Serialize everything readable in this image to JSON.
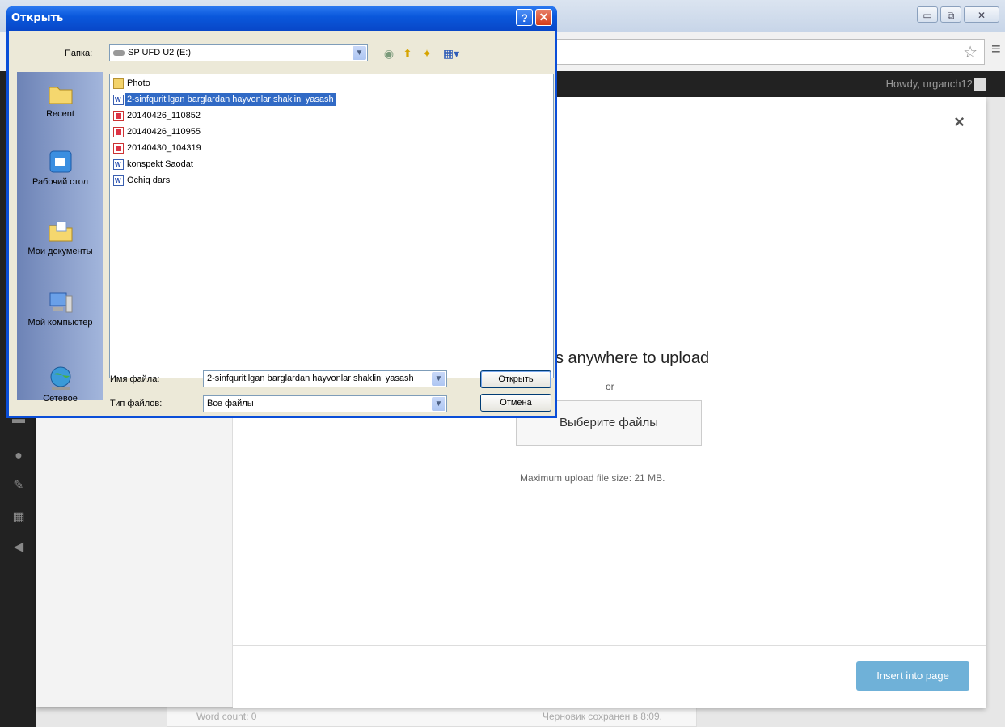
{
  "browser": {
    "window_controls": {
      "minimize": "▭",
      "restore": "⧉",
      "close": "✕"
    },
    "star_icon": "star-icon",
    "menu_icon": "menu-icon"
  },
  "wp": {
    "adminbar": {
      "howdy": "Howdy, urganch12"
    },
    "footer": {
      "word_count": "Word count: 0",
      "draft_saved": "Черновик сохранен в 8:09."
    }
  },
  "media_modal": {
    "close": "×",
    "upload_title": "s anywhere to upload",
    "or": "or",
    "select_files": "Выберите файлы",
    "max_size": "Maximum upload file size: 21 MB.",
    "insert_button": "Insert into page"
  },
  "dialog": {
    "title": "Открыть",
    "help": "?",
    "close": "✕",
    "folder_label": "Папка:",
    "folder_value": "SP UFD U2 (E:)",
    "places": [
      {
        "label": "Recent",
        "icon": "recent-folder-icon"
      },
      {
        "label": "Рабочий стол",
        "icon": "desktop-icon"
      },
      {
        "label": "Мои документы",
        "icon": "my-documents-icon"
      },
      {
        "label": "Мой компьютер",
        "icon": "my-computer-icon"
      },
      {
        "label": "Сетевое",
        "icon": "network-icon"
      }
    ],
    "files": [
      {
        "name": "Photo",
        "type": "folder"
      },
      {
        "name": "2-sinfquritilgan barglardan hayvonlar shaklini yasash",
        "type": "doc",
        "selected": true
      },
      {
        "name": "20140426_110852",
        "type": "image"
      },
      {
        "name": "20140426_110955",
        "type": "image"
      },
      {
        "name": "20140430_104319",
        "type": "image"
      },
      {
        "name": "konspekt Saodat",
        "type": "doc"
      },
      {
        "name": "Ochiq dars",
        "type": "doc"
      }
    ],
    "filename_label": "Имя файла:",
    "filename_value": "2-sinfquritilgan barglardan hayvonlar shaklini yasash",
    "filetype_label": "Тип файлов:",
    "filetype_value": "Все файлы",
    "open_button": "Открыть",
    "cancel_button": "Отмена"
  }
}
